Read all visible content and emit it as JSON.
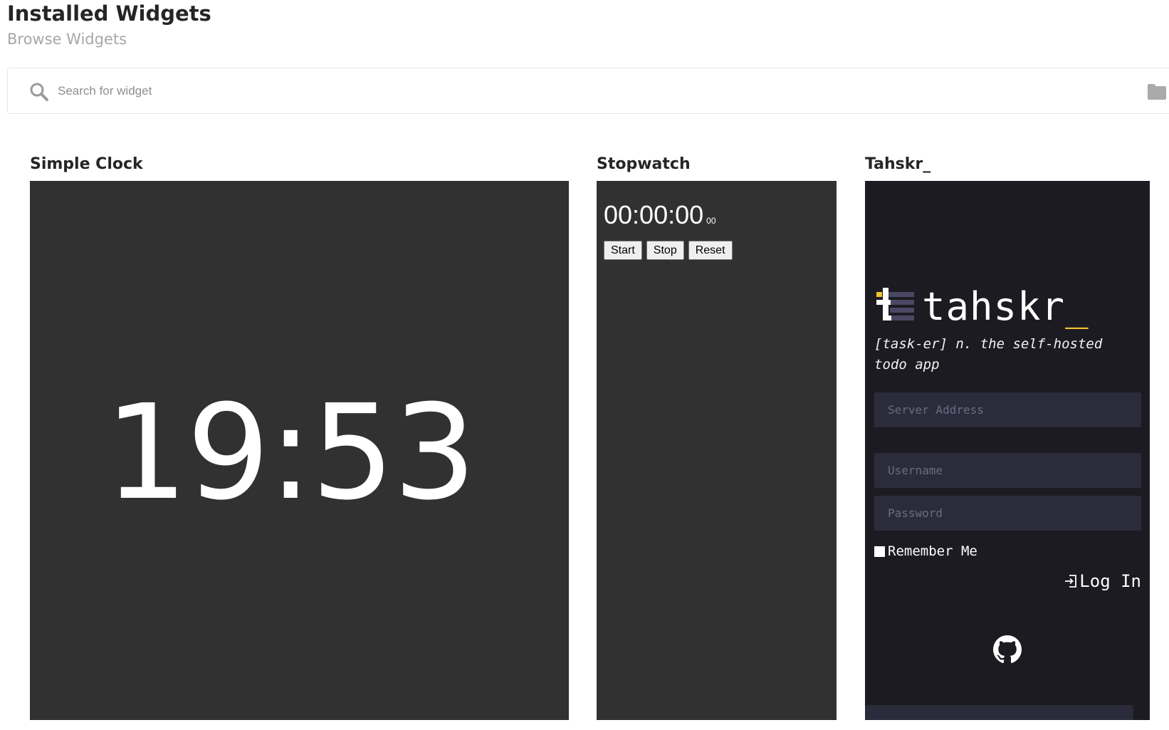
{
  "header": {
    "title": "Installed Widgets",
    "subtitle": "Browse Widgets"
  },
  "search": {
    "placeholder": "Search for widget",
    "value": ""
  },
  "widgets": {
    "clock": {
      "title": "Simple Clock",
      "time": "19:53"
    },
    "stopwatch": {
      "title": "Stopwatch",
      "time": "00:00:00",
      "milliseconds": "00",
      "start_label": "Start",
      "stop_label": "Stop",
      "reset_label": "Reset"
    },
    "tahskr": {
      "title": "Tahskr_",
      "brand": "tahskr",
      "brand_cursor": "_",
      "tagline": "[task-er] n. the self-hosted todo app",
      "server_placeholder": "Server Address",
      "username_placeholder": "Username",
      "password_placeholder": "Password",
      "remember_label": "Remember Me",
      "login_label": "Log In",
      "accent_color": "#f1c232"
    }
  },
  "icons": [
    "search-icon",
    "folder-icon",
    "tahskr-logo-icon",
    "login-icon",
    "github-icon"
  ]
}
